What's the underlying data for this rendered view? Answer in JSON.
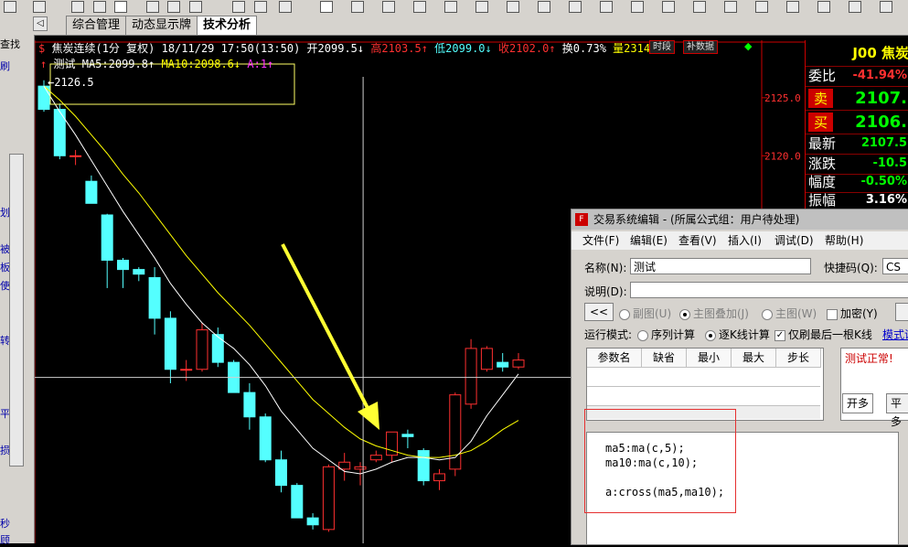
{
  "tabs": [
    "综合管理",
    "动态显示牌",
    "技术分析"
  ],
  "left_strip_chars": [
    "查找",
    "刷",
    "划",
    "被",
    "板",
    "使",
    "转",
    "平",
    "损",
    "秒",
    "顾"
  ],
  "chart_header": {
    "name": "焦炭连续(1分 复权) 18/11/29 17:50(13:50)",
    "open": "开2099.5↓",
    "high": "高2103.5↑",
    "low": "低2099.0↓",
    "close": "收2102.0↑",
    "turnover": "换0.73%",
    "volume": "量2314",
    "btn_period": "时段",
    "btn_supp": "补数据"
  },
  "indicator_line": {
    "name": "测试",
    "ma5": "MA5:2099.8↑",
    "ma10": "MA10:2098.6↓",
    "a": "A:1↑"
  },
  "price_marker": "2126.5",
  "price_axis": [
    "2125.0",
    "2120.0"
  ],
  "right_panel": {
    "title": "J00 焦炭",
    "rows": [
      {
        "label": "委比",
        "value": "-41.94%",
        "color": "#ff3030"
      },
      {
        "label": "卖",
        "value": "2107.",
        "color": "#00ff00"
      },
      {
        "label": "买",
        "value": "2106.",
        "color": "#00ff00"
      },
      {
        "label": "最新",
        "value": "2107.5",
        "color": "#00ff00"
      },
      {
        "label": "涨跌",
        "value": "-10.5",
        "color": "#00ff00"
      },
      {
        "label": "幅度",
        "value": "-0.50%",
        "color": "#00ff00"
      },
      {
        "label": "振幅",
        "value": "3.16%",
        "color": "#ffffff"
      }
    ]
  },
  "dialog": {
    "title": "交易系统编辑 - (所属公式组：用户待处理)",
    "menu": [
      "文件(F)",
      "编辑(E)",
      "查看(V)",
      "插入(I)",
      "调试(D)",
      "帮助(H)"
    ],
    "name_label": "名称(N):",
    "name_value": "测试",
    "shortcut_label": "快捷码(Q):",
    "shortcut_value": "CS",
    "desc_label": "说明(D):",
    "btn_back": "<<",
    "radio_subplot": "副图(U)",
    "radio_main_overlay": "主图叠加(J)",
    "radio_main": "主图(W)",
    "chk_encrypt": "加密(Y)",
    "run_mode_label": "运行模式:",
    "run_seq": "序列计算",
    "run_tick": "逐K线计算",
    "chk_last_only": "仅刷最后一根K线",
    "mode_link": "模式说",
    "param_headers": [
      "参数名",
      "缺省",
      "最小",
      "最大",
      "步长"
    ],
    "test_status": "测试正常!",
    "side_tabs": [
      "开多",
      "平多"
    ],
    "code": [
      "ma5:ma(c,5);",
      "ma10:ma(c,10);",
      "",
      "a:cross(ma5,ma10);"
    ]
  },
  "colors": {
    "up": "#ff3030",
    "down": "#54ffff",
    "ma5": "#ffffff",
    "ma10": "#ffff00",
    "arrow": "#ffff33"
  },
  "chart_data": {
    "type": "candlestick",
    "candles": [
      {
        "o": 2126.0,
        "h": 2126.5,
        "l": 2123.8,
        "c": 2124.0
      },
      {
        "o": 2124.0,
        "h": 2124.5,
        "l": 2119.7,
        "c": 2120.0
      },
      {
        "o": 2120.0,
        "h": 2120.5,
        "l": 2119.2,
        "c": 2120.0
      },
      {
        "o": 2117.8,
        "h": 2118.3,
        "l": 2115.9,
        "c": 2115.9
      },
      {
        "o": 2114.9,
        "h": 2115.0,
        "l": 2108.6,
        "c": 2111.0
      },
      {
        "o": 2111.0,
        "h": 2111.2,
        "l": 2108.6,
        "c": 2110.2
      },
      {
        "o": 2110.2,
        "h": 2110.4,
        "l": 2109.2,
        "c": 2109.8
      },
      {
        "o": 2109.5,
        "h": 2110.4,
        "l": 2104.6,
        "c": 2106.0
      },
      {
        "o": 2106.0,
        "h": 2106.6,
        "l": 2100.4,
        "c": 2101.6
      },
      {
        "o": 2101.6,
        "h": 2102.4,
        "l": 2100.6,
        "c": 2101.6
      },
      {
        "o": 2101.6,
        "h": 2105.6,
        "l": 2101.4,
        "c": 2105.0
      },
      {
        "o": 2104.6,
        "h": 2105.2,
        "l": 2101.8,
        "c": 2102.2
      },
      {
        "o": 2102.2,
        "h": 2102.4,
        "l": 2099.6,
        "c": 2099.6
      },
      {
        "o": 2099.6,
        "h": 2100.4,
        "l": 2096.4,
        "c": 2097.5
      },
      {
        "o": 2097.5,
        "h": 2097.8,
        "l": 2093.6,
        "c": 2093.8
      },
      {
        "o": 2093.8,
        "h": 2094.6,
        "l": 2091.0,
        "c": 2091.6
      },
      {
        "o": 2091.6,
        "h": 2091.8,
        "l": 2088.8,
        "c": 2088.8
      },
      {
        "o": 2088.8,
        "h": 2089.2,
        "l": 2087.8,
        "c": 2088.2
      },
      {
        "o": 2087.8,
        "h": 2093.4,
        "l": 2087.6,
        "c": 2093.2
      },
      {
        "o": 2093.0,
        "h": 2094.4,
        "l": 2092.0,
        "c": 2093.6
      },
      {
        "o": 2093.0,
        "h": 2093.6,
        "l": 2091.6,
        "c": 2093.2
      },
      {
        "o": 2093.8,
        "h": 2094.6,
        "l": 2093.6,
        "c": 2094.2
      },
      {
        "o": 2094.2,
        "h": 2096.2,
        "l": 2093.6,
        "c": 2096.2
      },
      {
        "o": 2096.0,
        "h": 2096.4,
        "l": 2094.8,
        "c": 2095.8
      },
      {
        "o": 2094.6,
        "h": 2094.8,
        "l": 2091.6,
        "c": 2092.0
      },
      {
        "o": 2092.0,
        "h": 2093.0,
        "l": 2091.2,
        "c": 2092.6
      },
      {
        "o": 2093.0,
        "h": 2099.6,
        "l": 2092.4,
        "c": 2099.4
      },
      {
        "o": 2098.6,
        "h": 2104.2,
        "l": 2098.2,
        "c": 2103.4
      },
      {
        "o": 2101.6,
        "h": 2103.6,
        "l": 2101.4,
        "c": 2103.4
      },
      {
        "o": 2102.2,
        "h": 2103.0,
        "l": 2101.4,
        "c": 2101.8
      },
      {
        "o": 2101.8,
        "h": 2103.0,
        "l": 2101.6,
        "c": 2102.4
      }
    ],
    "ma5": [
      2126.0,
      2123.8,
      2121.8,
      2119.6,
      2117.4,
      2115.2,
      2113.2,
      2111.2,
      2109.0,
      2107.2,
      2105.6,
      2104.4,
      2103.4,
      2102.0,
      2100.2,
      2098.0,
      2096.4,
      2094.8,
      2093.8,
      2092.8,
      2092.6,
      2093.0,
      2093.6,
      2094.0,
      2094.0,
      2093.8,
      2094.0,
      2095.4,
      2097.6,
      2099.4,
      2101.2
    ],
    "ma10": [
      2126.0,
      2124.8,
      2123.4,
      2121.8,
      2120.2,
      2118.4,
      2116.8,
      2115.0,
      2113.2,
      2111.4,
      2109.8,
      2108.2,
      2106.8,
      2105.4,
      2103.8,
      2102.2,
      2100.6,
      2099.0,
      2097.8,
      2096.6,
      2095.6,
      2095.0,
      2094.6,
      2094.2,
      2094.0,
      2094.0,
      2094.2,
      2094.6,
      2095.4,
      2096.4,
      2097.2
    ],
    "ylim": [
      2087.0,
      2126.8
    ],
    "y_ticks": [
      2125.0,
      2120.0
    ],
    "cursor_index": 17,
    "cursor_price": 2100.9
  }
}
